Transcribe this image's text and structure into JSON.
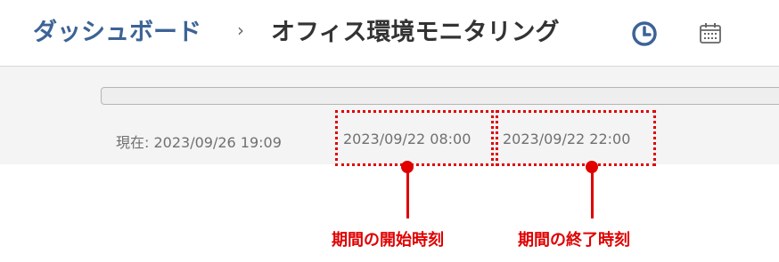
{
  "header": {
    "breadcrumb_root": "ダッシュボード",
    "separator": "›",
    "title": "オフィス環境モニタリング",
    "icons": [
      "clock-icon",
      "calendar-icon"
    ]
  },
  "timeline": {
    "current_label": "現在: 2023/09/26 19:09",
    "start_time": "2023/09/22 08:00",
    "end_time": "2023/09/22 22:00"
  },
  "annotations": {
    "start_label": "期間の開始時刻",
    "end_label": "期間の終了時刻"
  },
  "colors": {
    "accent": "#3d6396",
    "annotation": "#e00000",
    "panel_bg": "#f4f4f4"
  }
}
